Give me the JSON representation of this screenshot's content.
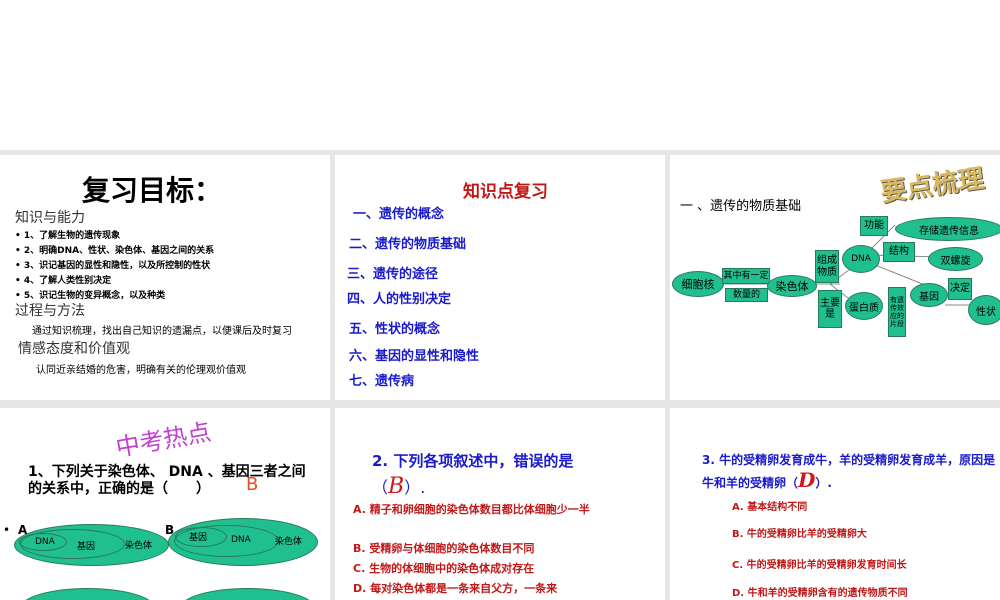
{
  "slide1": {
    "title": "复习目标：",
    "h1": "知识与能力",
    "items": [
      "1、了解生物的遗传现象",
      "2、明确DNA、性状、染色体、基因之间的关系",
      "3、识记基因的显性和隐性，以及所控制的性状",
      "4、了解人类性别决定",
      "5、识记生物的变异概念，以及种类"
    ],
    "h2": "过程与方法",
    "p2": "通过知识梳理，找出自己知识的遗漏点，以便课后及时复习",
    "h3": "情感态度和价值观",
    "p3": "认同近亲结婚的危害，明确有关的伦理观价值观"
  },
  "slide2": {
    "title": "知识点复习",
    "items": [
      "一、遗传的概念",
      "二、遗传的物质基础",
      "三、遗传的途径",
      "四、人的性别决定",
      "五、性状的概念",
      "六、基因的显性和隐性",
      "七、遗传病"
    ]
  },
  "slide3": {
    "wordart": "要点梳理",
    "heading": "一 、遗传的物质基础",
    "nodes": {
      "nucleus": "细胞核",
      "has": "其中有一定",
      "amount": "数量的",
      "chromosome": "染色体",
      "compose": "组成物质",
      "main": "主要是",
      "dna": "DNA",
      "protein": "蛋白质",
      "function": "功能",
      "store": "存储遗传信息",
      "structure": "结构",
      "helix": "双螺旋",
      "segment": "有遗传效应的片段",
      "gene": "基因",
      "decide": "决定",
      "trait": "性状"
    }
  },
  "slide4": {
    "wordart": "中考热点",
    "question": "1、下列关于染色体、 DNA 、基因三者之间的关系中，正确的是（　　）",
    "answer": "B",
    "bullet": "•",
    "optA": "A",
    "optB": "B",
    "ellA": [
      "DNA",
      "基因",
      "染色体"
    ],
    "ellB": [
      "基因",
      "DNA",
      "染色体"
    ]
  },
  "slide5": {
    "question": "2. 下列各项叙述中，错误的是",
    "paren_open": "（",
    "answer": "B",
    "paren_close": "）.",
    "options": [
      "A. 精子和卵细胞的染色体数目都比体细胞少一半",
      "B. 受精卵与体细胞的染色体数目不同",
      "C. 生物的体细胞中的染色体成对存在",
      "D. 每对染色体都是一条来自父方，一条来"
    ]
  },
  "slide6": {
    "question": "3. 牛的受精卵发育成牛，羊的受精卵发育成羊，原因是牛和羊的受精卵（",
    "answer": "D",
    "paren_close": "）.",
    "options": [
      "A. 基本结构不同",
      "B. 牛的受精卵比羊的受精卵大",
      "C. 牛的受精卵比羊的受精卵发育时间长",
      "D. 牛和羊的受精卵含有的遗传物质不同"
    ]
  }
}
